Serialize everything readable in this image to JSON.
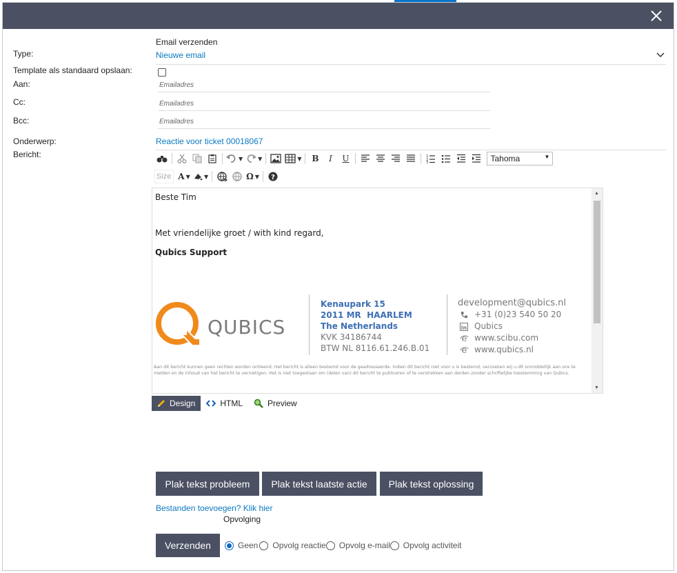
{
  "form": {
    "section_title": "Email verzenden",
    "labels": {
      "type": "Type:",
      "template": "Template als standaard opslaan:",
      "to": "Aan:",
      "cc": "Cc:",
      "bcc": "Bcc:",
      "subject": "Onderwerp:",
      "message": "Bericht:"
    },
    "type_value": "Nieuwe email",
    "template_checked": false,
    "to_placeholder": "Emailadres",
    "cc_placeholder": "Emailadres",
    "bcc_placeholder": "Emailadres",
    "subject_value": "Reactie voor ticket 00018067"
  },
  "editor": {
    "font_name": "Tahoma",
    "size_placeholder": "Size",
    "greeting": "Beste Tim",
    "closing": "Met vriendelijke groet / with kind regard,",
    "sender": "Qubics Support",
    "signature": {
      "logo_text": "QUBICS",
      "address_bold": [
        "Kenaupark 15",
        "2011 MR  HAARLEM",
        "The Netherlands"
      ],
      "address_plain": [
        "KVK 34186744",
        "BTW NL 8116.61.246.B.01"
      ],
      "email": "development@qubics.nl",
      "phone": "+31 (0)23 540 50 20",
      "linkedin": "Qubics",
      "site1": "www.scibu.com",
      "site2": "www.qubics.nl"
    },
    "disclaimer": "Aan dit bericht kunnen geen rechten worden ontleend. Het bericht is alleen bestemd voor de geadresseerde. Indien dit bericht niet voor u is bestemd, verzoeken wij u dit onmiddellijk aan ons te melden en de inhoud van het bericht te vernietigen. Het is niet toegestaan om (delen van) dit bericht te publiceren of te verstrekken aan derden zonder schriftelijke toestemming van Qubics.",
    "modes": [
      "Design",
      "HTML",
      "Preview"
    ]
  },
  "buttons": {
    "paste_problem": "Plak tekst probleem",
    "paste_last_action": "Plak tekst laatste actie",
    "paste_solution": "Plak tekst oplossing",
    "add_files": "Bestanden toevoegen? Klik hier",
    "followup_title": "Opvolging",
    "send": "Verzenden"
  },
  "followup_options": [
    "Geen",
    "Opvolg reactie",
    "Opvolg e-mail",
    "Opvolg activiteit"
  ],
  "followup_selected": "Geen",
  "colors": {
    "header": "#4b5063",
    "link": "#0a7ac2",
    "signature_blue": "#3d6fb4",
    "logo_orange": "#f08a1c"
  }
}
